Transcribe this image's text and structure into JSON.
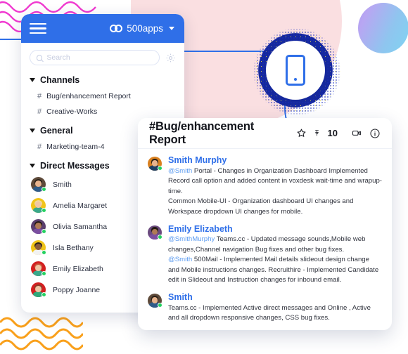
{
  "brand": {
    "name": "500apps",
    "logo_icon": "infinity-icon",
    "menu_icon": "hamburger-icon",
    "chevron_icon": "chevron-down-icon",
    "header_color": "#2f6fe8"
  },
  "search": {
    "placeholder": "Search",
    "value": "",
    "icon": "search-icon",
    "settings_icon": "gear-icon"
  },
  "sidebar": {
    "groups": [
      {
        "title": "Channels",
        "toggle_icon": "caret-down-icon",
        "channels": [
          {
            "hash": "#",
            "name": "Bug/enhancement Report"
          },
          {
            "hash": "#",
            "name": "Creative-Works"
          }
        ]
      },
      {
        "title": "General",
        "toggle_icon": "caret-down-icon",
        "channels": [
          {
            "hash": "#",
            "name": "Marketing-team-4"
          }
        ]
      }
    ],
    "direct_messages": {
      "title": "Direct Messages",
      "toggle_icon": "caret-down-icon",
      "people": [
        {
          "name": "Smith",
          "status": "online",
          "hair": "#2a2118",
          "skin": "#e8b48e",
          "shirt": "#2f5c8a",
          "bg": "#5e4a3a"
        },
        {
          "name": "Amelia Margaret",
          "status": "online",
          "hair": "#f0d79a",
          "skin": "#f0c6a4",
          "shirt": "#3aa88a",
          "bg": "#f0c419"
        },
        {
          "name": "Olivia Samantha",
          "status": "online",
          "hair": "#241a14",
          "skin": "#b07a55",
          "shirt": "#7b4fa0",
          "bg": "#5b3f6e"
        },
        {
          "name": "Isla Bethany",
          "status": "online",
          "hair": "#2c211a",
          "skin": "#8a5c3a",
          "shirt": "#f2f2f2",
          "bg": "#f0c419"
        },
        {
          "name": "Emily Elizabeth",
          "status": "online",
          "hair": "#c9583a",
          "skin": "#f0c6a4",
          "shirt": "#3aa88a",
          "bg": "#d32020"
        },
        {
          "name": "Poppy Joanne",
          "status": "online",
          "hair": "#8a3f2a",
          "skin": "#f0c6a4",
          "shirt": "#2fa87a",
          "bg": "#d32020"
        }
      ]
    }
  },
  "panel": {
    "title": "#Bug/enhancement Report",
    "star_icon": "star-icon",
    "pin_icon": "pin-icon",
    "pin_count": "10",
    "video_icon": "video-camera-icon",
    "info_icon": "info-circle-icon",
    "messages": [
      {
        "author": "Smith Murphy",
        "status": "online",
        "avatar": {
          "hair": "#2a2118",
          "skin": "#e8b48e",
          "shirt": "#1f3f63",
          "bg": "#d9801f"
        },
        "lines": [
          {
            "mention": "@Smith",
            "text": " Portal - Changes in Organization Dashboard Implemented Record call option and added content in voxdesk wait-time and wrapup-time."
          },
          {
            "mention": "",
            "text": "Common Mobile-UI - Organization dashboard UI changes and Workspace dropdown UI changes for mobile."
          }
        ]
      },
      {
        "author": "Emily Elizabeth",
        "status": "online",
        "avatar": {
          "hair": "#241a14",
          "skin": "#b07a55",
          "shirt": "#7b4fa0",
          "bg": "#6a4a7e"
        },
        "lines": [
          {
            "mention": "@SmithMurphy",
            "text": " Teams.cc - Updated message sounds,Mobile web changes,Channel navigation Bug fixes and other bug fixes."
          },
          {
            "mention": "@Smith",
            "text": " 500Mail - Implemented Mail details slideout design change and Mobile instructions changes. Recruithire - Implemented Candidate edit in Slideout and Instruction changes for inbound email."
          }
        ]
      },
      {
        "author": "Smith",
        "status": "online",
        "avatar": {
          "hair": "#2a2118",
          "skin": "#e8b48e",
          "shirt": "#2f5c8a",
          "bg": "#5e4a3a"
        },
        "lines": [
          {
            "mention": "",
            "text": "Teams.cc - Implemented Active direct messages and Online , Active and all dropdown responsive changes, CSS bug fixes."
          }
        ]
      }
    ]
  },
  "decor": {
    "pink_blob_color": "#fadfe1",
    "gradient_circle": {
      "from": "#ab9cf0",
      "to": "#7fd4f2"
    },
    "phone_icon": "mobile-phone-icon",
    "accent_blue": "#2f6fe8",
    "zigzag_top_color": "#f03ad0",
    "zigzag_bottom_color": "#f9a01b"
  }
}
